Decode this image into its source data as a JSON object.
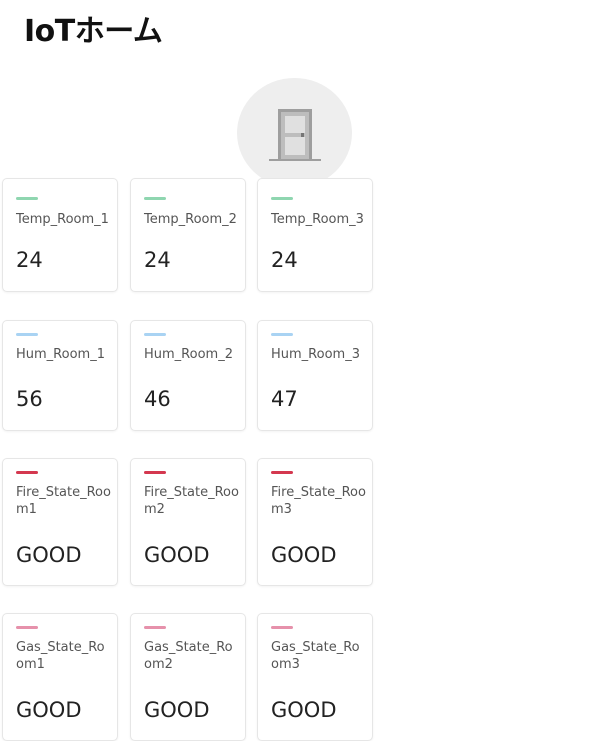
{
  "header": {
    "title": "IoTホーム"
  },
  "hero": {
    "icon": "door-icon"
  },
  "colors": {
    "temp_accent": "#8fd6b0",
    "hum_accent": "#a9d3f3",
    "fire_accent": "#d4384f",
    "gas_accent": "#e691ab"
  },
  "rows": [
    {
      "cards": [
        {
          "label": "Temp_Room_1",
          "value": "24"
        },
        {
          "label": "Temp_Room_2",
          "value": "24"
        },
        {
          "label": "Temp_Room_3",
          "value": "24"
        }
      ]
    },
    {
      "cards": [
        {
          "label": "Hum_Room_1",
          "value": "56"
        },
        {
          "label": "Hum_Room_2",
          "value": "46"
        },
        {
          "label": "Hum_Room_3",
          "value": "47"
        }
      ]
    },
    {
      "cards": [
        {
          "label": "Fire_State_Room1",
          "value": "GOOD"
        },
        {
          "label": "Fire_State_Room2",
          "value": "GOOD"
        },
        {
          "label": "Fire_State_Room3",
          "value": "GOOD"
        }
      ]
    },
    {
      "cards": [
        {
          "label": "Gas_State_Room1",
          "value": "GOOD"
        },
        {
          "label": "Gas_State_Room2",
          "value": "GOOD"
        },
        {
          "label": "Gas_State_Room3",
          "value": "GOOD"
        }
      ]
    }
  ]
}
